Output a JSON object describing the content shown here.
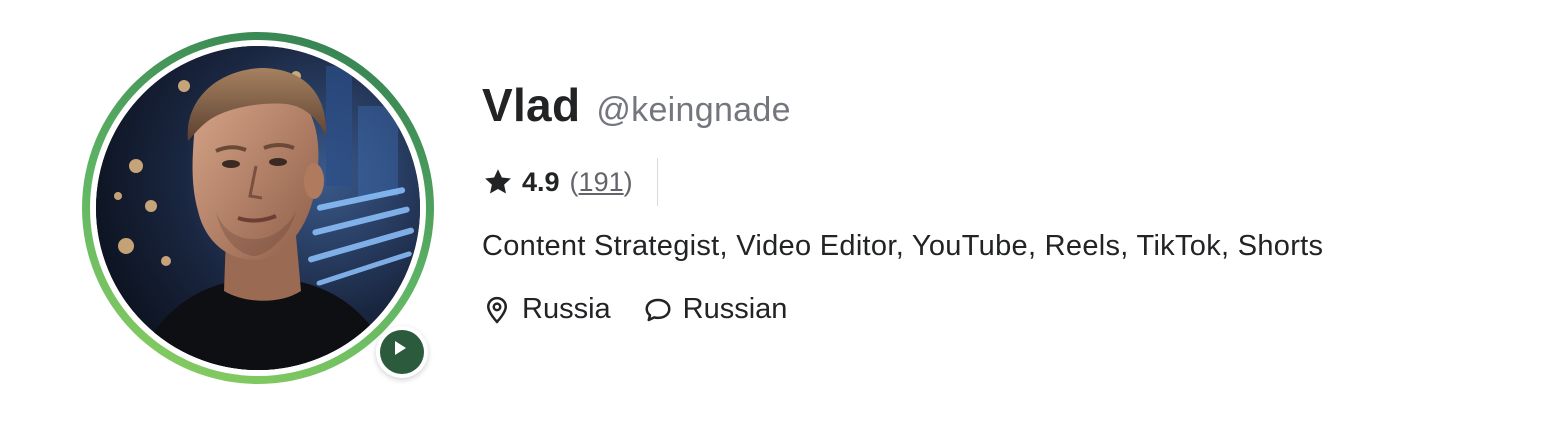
{
  "profile": {
    "name": "Vlad",
    "username": "@keingnade",
    "rating": "4.9",
    "reviews_open": "(",
    "reviews_count": "191",
    "reviews_close": ")",
    "tagline": "Content Strategist, Video Editor, YouTube, Reels, TikTok, Shorts",
    "location": "Russia",
    "language": "Russian"
  },
  "icons": {
    "star": "star-icon",
    "location": "location-pin-icon",
    "language": "speech-bubble-icon",
    "play": "play-icon"
  },
  "colors": {
    "ring_light": "#8ed060",
    "ring_dark": "#2f7a4f",
    "play_button": "#2c5a3d",
    "text_primary": "#222325",
    "text_secondary": "#74767e"
  }
}
